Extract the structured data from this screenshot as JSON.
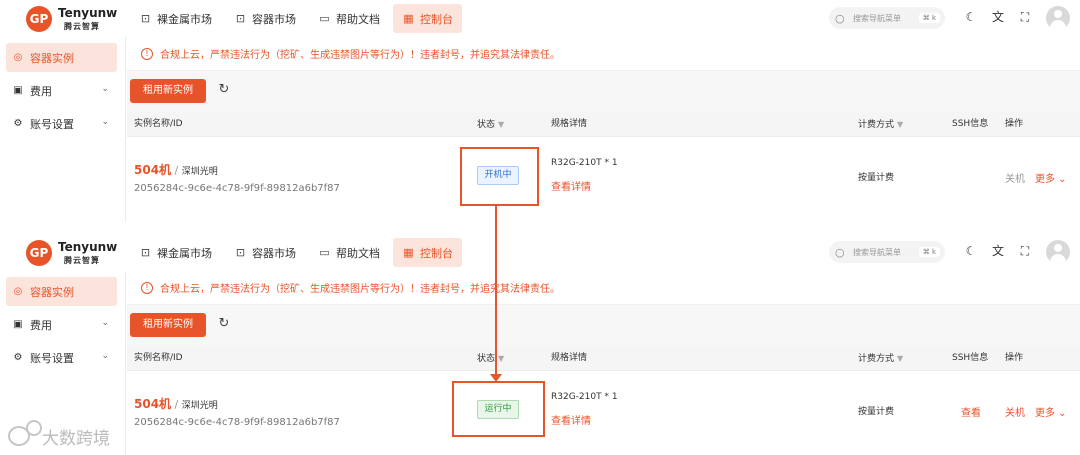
{
  "topbar": {
    "logo_mark": "GP",
    "brand_en": "Tenyunw",
    "brand_cn": "腾云智算",
    "nav": [
      {
        "label": "裸金属市场",
        "icon": "bag-icon"
      },
      {
        "label": "容器市场",
        "icon": "bag-icon"
      },
      {
        "label": "帮助文档",
        "icon": "book-icon"
      },
      {
        "label": "控制台",
        "icon": "dashboard-icon",
        "active": true
      }
    ],
    "search_placeholder": "搜索导航菜单",
    "search_shortcut": "⌘ k",
    "icons": [
      "moon-icon",
      "translate-icon",
      "fullscreen-icon",
      "avatar"
    ]
  },
  "sidebar": {
    "items": [
      {
        "label": "容器实例",
        "icon": "container-icon",
        "active": true
      },
      {
        "label": "费用",
        "icon": "billing-icon",
        "expandable": true
      },
      {
        "label": "账号设置",
        "icon": "settings-icon",
        "expandable": true
      }
    ]
  },
  "notice": "合规上云，严禁违法行为（挖矿、生成违禁图片等行为）！违者封号，并追究其法律责任。",
  "toolbar": {
    "rent_label": "租用新实例"
  },
  "table": {
    "headers": {
      "name": "实例名称/ID",
      "status": "状态",
      "spec": "规格详情",
      "billing": "计费方式",
      "ssh": "SSH信息",
      "actions": "操作"
    }
  },
  "before": {
    "name": "504机",
    "location": "深圳光明",
    "id": "2056284c-9c6e-4c78-9f9f-89812a6b7f87",
    "status": "开机中",
    "spec": "R32G-210T * 1",
    "detail_link": "查看详情",
    "billing": "按量计费",
    "ssh": "",
    "shutdown": "关机",
    "more": "更多"
  },
  "after": {
    "name": "504机",
    "location": "深圳光明",
    "id": "2056284c-9c6e-4c78-9f9f-89812a6b7f87",
    "status": "运行中",
    "spec": "R32G-210T * 1",
    "detail_link": "查看详情",
    "billing": "按量计费",
    "ssh": "查看",
    "shutdown": "关机",
    "more": "更多"
  },
  "colors": {
    "accent": "#e8542a",
    "status_starting": "#2e6fd1",
    "status_running": "#2f9a3c"
  },
  "watermark": "大数跨境"
}
